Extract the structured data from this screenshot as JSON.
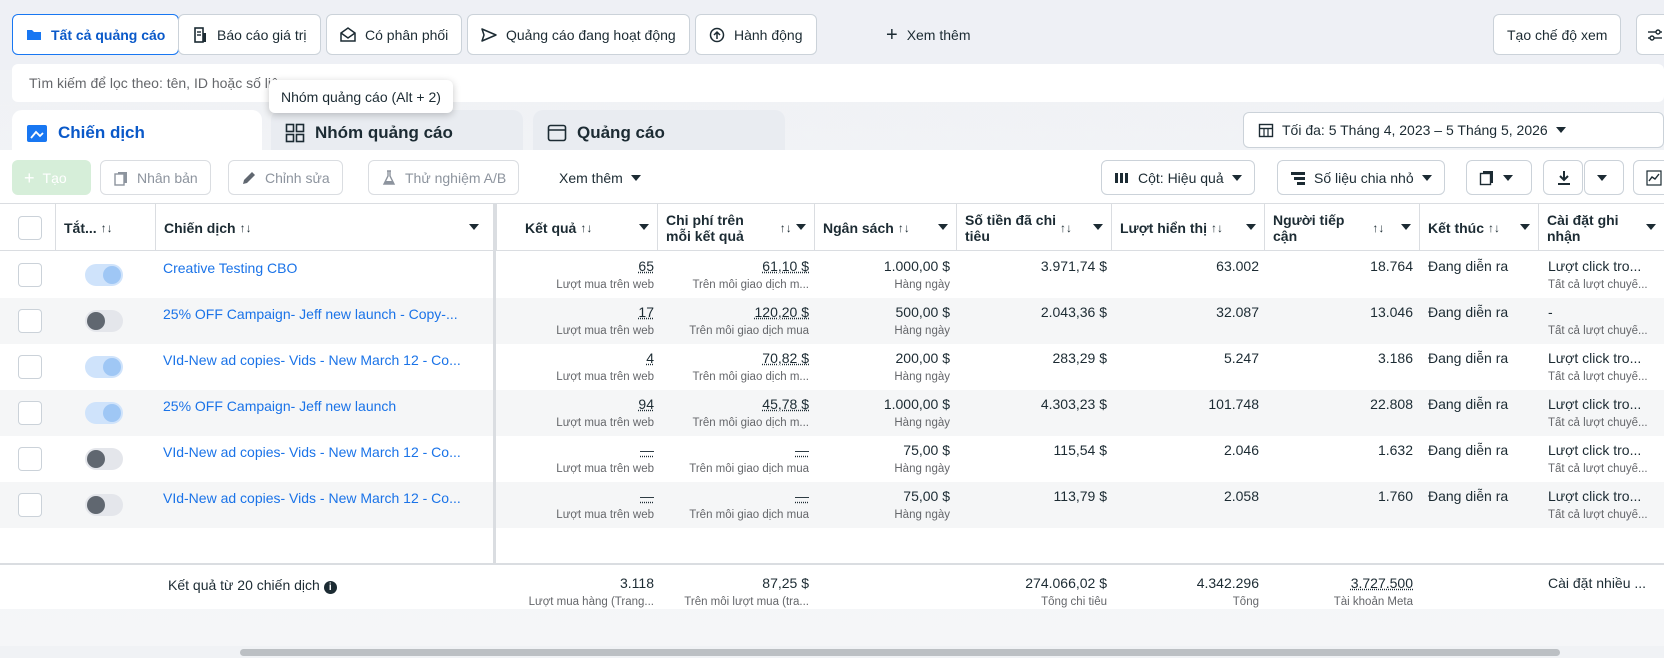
{
  "filters": {
    "all_ads": "Tất cả quảng cáo",
    "value_report": "Báo cáo giá trị",
    "has_delivery": "Có phân phối",
    "active_ads": "Quảng cáo đang hoạt động",
    "actions": "Hành động",
    "see_more": "Xem thêm",
    "create_view": "Tạo chế độ xem"
  },
  "search": {
    "placeholder": "Tìm kiếm để lọc theo: tên, ID hoặc số liệ"
  },
  "tooltip": "Nhóm quảng cáo (Alt + 2)",
  "level_tabs": [
    "Chiến dịch",
    "Nhóm quảng cáo",
    "Quảng cáo"
  ],
  "date_range": "Tối đa: 5 Tháng 4, 2023 – 5 Tháng 5, 2026",
  "toolbar": {
    "create": "Tạo",
    "duplicate": "Nhân bản",
    "edit": "Chỉnh sửa",
    "ab_test": "Thử nghiệm A/B",
    "more": "Xem thêm",
    "columns": "Cột: Hiệu quả",
    "breakdown": "Số liệu chia nhỏ"
  },
  "columns": {
    "status": "Tắt...",
    "campaign": "Chiến dịch",
    "results": "Kết quả",
    "cpr_line1": "Chi phí trên",
    "cpr_line2": "mỗi kết quả",
    "budget": "Ngân sách",
    "spent_line1": "Số tiền đã chi",
    "spent_line2": "tiêu",
    "impressions": "Lượt hiển thị",
    "reach_line1": "Người tiếp",
    "reach_line2": "cận",
    "ends": "Kết thúc",
    "attr_line1": "Cài đặt ghi",
    "attr_line2": "nhận"
  },
  "rows": [
    {
      "name": "Creative Testing CBO",
      "on": true,
      "result": "65",
      "result_sub": "Lượt mua trên web",
      "cpr": "61,10 $",
      "cpr_sub": "Trên mỗi giao dịch m...",
      "budget": "1.000,00 $",
      "budget_sub": "Hàng ngày",
      "spent": "3.971,74 $",
      "impressions": "63.002",
      "reach": "18.764",
      "ends": "Đang diễn ra",
      "attr": "Lượt click tro...",
      "attr_sub": "Tất cả lượt chuyể..."
    },
    {
      "name": "25% OFF Campaign- Jeff new launch - Copy-...",
      "on": false,
      "result": "17",
      "result_sub": "Lượt mua trên web",
      "cpr": "120,20 $",
      "cpr_sub": "Trên mỗi giao dịch mua",
      "budget": "500,00 $",
      "budget_sub": "Hàng ngày",
      "spent": "2.043,36 $",
      "impressions": "32.087",
      "reach": "13.046",
      "ends": "Đang diễn ra",
      "attr": "-",
      "attr_sub": "Tất cả lượt chuyể..."
    },
    {
      "name": "VId-New ad copies- Vids - New March 12 - Co...",
      "on": true,
      "result": "4",
      "result_sub": "Lượt mua trên web",
      "cpr": "70,82 $",
      "cpr_sub": "Trên mỗi giao dịch m...",
      "budget": "200,00 $",
      "budget_sub": "Hàng ngày",
      "spent": "283,29 $",
      "impressions": "5.247",
      "reach": "3.186",
      "ends": "Đang diễn ra",
      "attr": "Lượt click tro...",
      "attr_sub": "Tất cả lượt chuyể..."
    },
    {
      "name": "25% OFF Campaign- Jeff new launch",
      "on": true,
      "result": "94",
      "result_sub": "Lượt mua trên web",
      "cpr": "45,78 $",
      "cpr_sub": "Trên mỗi giao dịch m...",
      "budget": "1.000,00 $",
      "budget_sub": "Hàng ngày",
      "spent": "4.303,23 $",
      "impressions": "101.748",
      "reach": "22.808",
      "ends": "Đang diễn ra",
      "attr": "Lượt click tro...",
      "attr_sub": "Tất cả lượt chuyể..."
    },
    {
      "name": "VId-New ad copies- Vids - New March 12 - Co...",
      "on": false,
      "result": "—",
      "result_sub": "Lượt mua trên web",
      "cpr": "—",
      "cpr_sub": "Trên mỗi giao dịch mua",
      "budget": "75,00 $",
      "budget_sub": "Hàng ngày",
      "spent": "115,54 $",
      "impressions": "2.046",
      "reach": "1.632",
      "ends": "Đang diễn ra",
      "attr": "Lượt click tro...",
      "attr_sub": "Tất cả lượt chuyể..."
    },
    {
      "name": "VId-New ad copies- Vids - New March 12 - Co...",
      "on": false,
      "result": "—",
      "result_sub": "Lượt mua trên web",
      "cpr": "—",
      "cpr_sub": "Trên mỗi giao dịch mua",
      "budget": "75,00 $",
      "budget_sub": "Hàng ngày",
      "spent": "113,79 $",
      "impressions": "2.058",
      "reach": "1.760",
      "ends": "Đang diễn ra",
      "attr": "Lượt click tro...",
      "attr_sub": "Tất cả lượt chuyể..."
    }
  ],
  "totals": {
    "label": "Kết quả từ 20 chiến dịch",
    "result": "3.118",
    "result_sub": "Lượt mua hàng (Trang...",
    "cpr": "87,25 $",
    "cpr_sub": "Trên mỗi lượt mua (tra...",
    "spent": "274.066,02 $",
    "spent_sub": "Tổng chi tiêu",
    "impressions": "4.342.296",
    "impressions_sub": "Tổng",
    "reach": "3.727.500",
    "reach_sub": "Tài khoản Meta",
    "attr": "Cài đặt nhiều ..."
  },
  "colors": {
    "accent": "#1877f2",
    "link": "#1a73e8",
    "border": "#dadde1"
  }
}
